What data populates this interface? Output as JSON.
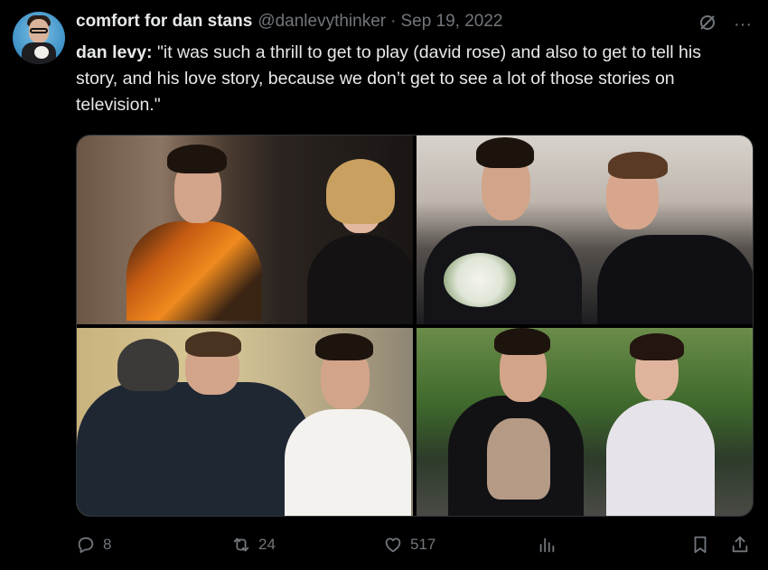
{
  "tweet": {
    "display_name": "comfort for dan stans",
    "handle": "@danlevythinker",
    "separator": "·",
    "date": "Sep 19, 2022",
    "text_speaker": "dan levy:",
    "text_body": " \"it was such a thrill to get to play (david rose) and also to get to tell his story, and his love story, because we don’t get to see a lot of those stories on television.\""
  },
  "header_icons": {
    "grok_icon": "slash-circle-icon",
    "more_icon": "more-icon",
    "more_glyph": "···"
  },
  "media": {
    "photos": [
      "photo-1",
      "photo-2",
      "photo-3",
      "photo-4"
    ]
  },
  "actions": {
    "replies": "8",
    "retweets": "24",
    "likes": "517"
  },
  "colors": {
    "background": "#000000",
    "text": "#e7e9ea",
    "secondary": "#71767b"
  }
}
